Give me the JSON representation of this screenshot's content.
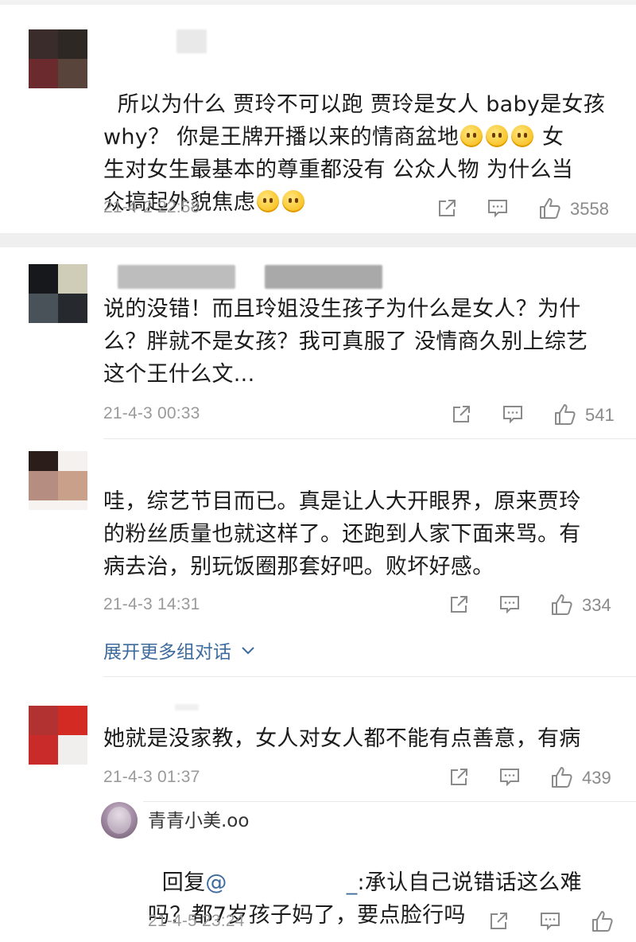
{
  "comments": [
    {
      "text": "所以为什么 贾玲不可以跑 贾玲是女人 baby是女孩\nwhy？ 你是王牌开播以来的情商盆地",
      "text_after_emoji": " 女\n生对女生最基本的尊重都没有 公众人物 为什么当\n众搞起外貌焦虑",
      "time": "21-4-2 22:58",
      "likes": "3558"
    },
    {
      "text": "说的没错！而且玲姐没生孩子为什么是女人？为什\n么？胖就不是女孩？我可真服了 没情商久别上综艺\n这个王什么文...",
      "time": "21-4-3 00:33",
      "likes": "541"
    },
    {
      "text": "哇，综艺节目而已。真是让人大开眼界，原来贾玲\n的粉丝质量也就这样了。还跑到人家下面来骂。有\n病去治，别玩饭圈那套好吧。败坏好感。",
      "time": "21-4-3 14:31",
      "likes": "334"
    },
    {
      "text": "她就是没家教，女人对女人都不能有点善意，有病",
      "time": "21-4-3 01:37",
      "likes": "439"
    }
  ],
  "expand_label": "展开更多组对话",
  "reply": {
    "username": "青青小美.oo",
    "prefix": "回复",
    "mention": "@",
    "mention_tail": "_",
    "text_line1": ":承认自己说错话这么难",
    "text_line2": "吗？都7岁孩子妈了，要点脸行吗",
    "time": "21-4-5 23:24"
  },
  "icons": {
    "share": "share-icon",
    "comment": "comment-icon",
    "like": "thumbs-up-icon"
  },
  "colors": {
    "link": "#3d6b9e",
    "meta": "#9a9a9a",
    "divider": "#e9e9e9"
  }
}
